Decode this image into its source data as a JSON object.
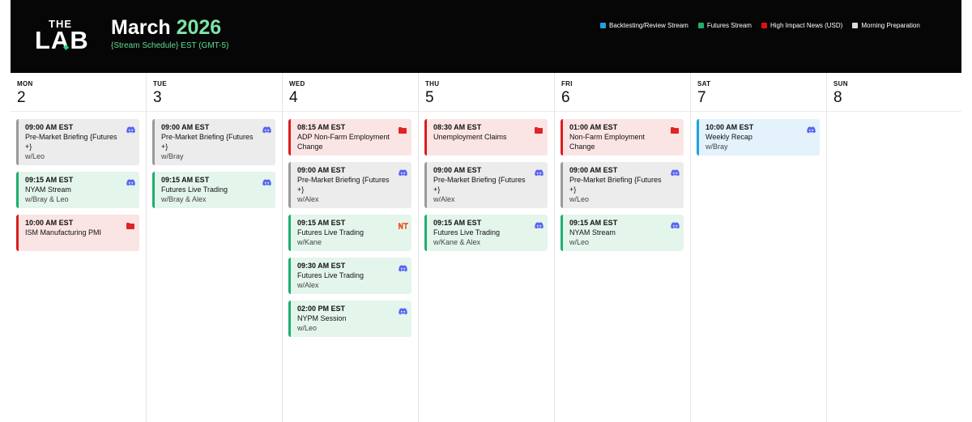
{
  "header": {
    "logo_top": "THE",
    "logo_main": "LAB",
    "month": "March",
    "year": "2026",
    "subtitle": "{Stream Schedule} EST (GMT-5)"
  },
  "legend": [
    {
      "label": "Backtesting/Review Stream",
      "color": "#1fa2de"
    },
    {
      "label": "Futures Stream",
      "color": "#1fae6e"
    },
    {
      "label": "High Impact News (USD)",
      "color": "#e01010"
    },
    {
      "label": "Morning Preparation",
      "color": "#dcdcdc"
    }
  ],
  "days": [
    {
      "name": "MON",
      "num": "2",
      "events": [
        {
          "time": "09:00 AM EST",
          "title": "Pre-Market Briefing {Futures +}",
          "host": "w/Leo",
          "category": "morning",
          "icon": "discord-icon"
        },
        {
          "time": "09:15 AM EST",
          "title": "NYAM Stream",
          "host": "w/Bray & Leo",
          "category": "futures",
          "icon": "discord-icon"
        },
        {
          "time": "10:00 AM EST",
          "title": "ISM Manufacturing PMI",
          "host": "",
          "category": "news",
          "icon": "folder-icon"
        }
      ]
    },
    {
      "name": "TUE",
      "num": "3",
      "events": [
        {
          "time": "09:00 AM EST",
          "title": "Pre-Market Briefing {Futures +}",
          "host": "w/Bray",
          "category": "morning",
          "icon": "discord-icon"
        },
        {
          "time": "09:15 AM EST",
          "title": "Futures Live Trading",
          "host": "w/Bray & Alex",
          "category": "futures",
          "icon": "discord-icon"
        }
      ]
    },
    {
      "name": "WED",
      "num": "4",
      "events": [
        {
          "time": "08:15 AM EST",
          "title": "ADP Non-Farm Employment Change",
          "host": "",
          "category": "news",
          "icon": "folder-icon"
        },
        {
          "time": "09:00 AM EST",
          "title": "Pre-Market Briefing {Futures +}",
          "host": "w/Alex",
          "category": "morning",
          "icon": "discord-icon"
        },
        {
          "time": "09:15 AM EST",
          "title": "Futures Live Trading",
          "host": "w/Kane",
          "category": "futures",
          "icon": "ninjatrader-icon"
        },
        {
          "time": "09:30 AM EST",
          "title": "Futures Live Trading",
          "host": "w/Alex",
          "category": "futures",
          "icon": "discord-icon"
        },
        {
          "time": "02:00 PM EST",
          "title": "NYPM Session",
          "host": "w/Leo",
          "category": "futures",
          "icon": "discord-icon"
        }
      ]
    },
    {
      "name": "THU",
      "num": "5",
      "events": [
        {
          "time": "08:30 AM EST",
          "title": "Unemployment Claims",
          "host": "",
          "category": "news",
          "icon": "folder-icon"
        },
        {
          "time": "09:00 AM EST",
          "title": "Pre-Market Briefing {Futures +}",
          "host": "w/Alex",
          "category": "morning",
          "icon": "discord-icon"
        },
        {
          "time": "09:15 AM EST",
          "title": "Futures Live Trading",
          "host": "w/Kane & Alex",
          "category": "futures",
          "icon": "discord-icon"
        }
      ]
    },
    {
      "name": "FRI",
      "num": "6",
      "events": [
        {
          "time": "01:00 AM EST",
          "title": "Non-Farm Employment Change",
          "host": "",
          "category": "news",
          "icon": "folder-icon"
        },
        {
          "time": "09:00 AM EST",
          "title": "Pre-Market Briefing {Futures +}",
          "host": "w/Leo",
          "category": "morning",
          "icon": "discord-icon"
        },
        {
          "time": "09:15 AM EST",
          "title": "NYAM Stream",
          "host": "w/Leo",
          "category": "futures",
          "icon": "discord-icon"
        }
      ]
    },
    {
      "name": "SAT",
      "num": "7",
      "events": [
        {
          "time": "10:00 AM EST",
          "title": "Weekly Recap",
          "host": "w/Bray",
          "category": "review",
          "icon": "discord-icon"
        }
      ]
    },
    {
      "name": "SUN",
      "num": "8",
      "events": []
    }
  ]
}
